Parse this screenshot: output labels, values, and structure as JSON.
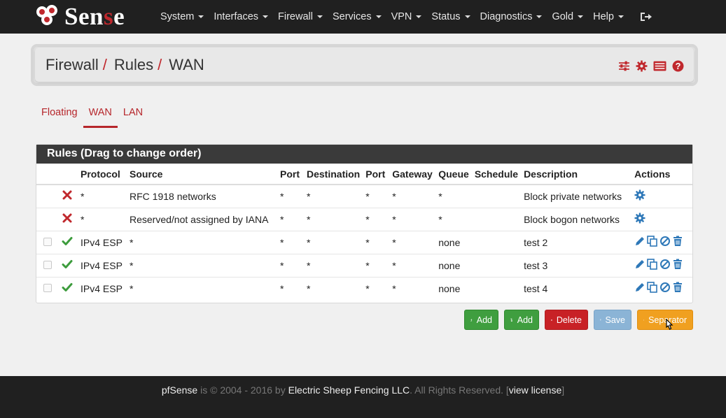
{
  "navbar": {
    "logo_text_a": "Sen",
    "logo_text_b": "s",
    "logo_text_c": "e",
    "items": [
      {
        "label": "System"
      },
      {
        "label": "Interfaces"
      },
      {
        "label": "Firewall"
      },
      {
        "label": "Services"
      },
      {
        "label": "VPN"
      },
      {
        "label": "Status"
      },
      {
        "label": "Diagnostics"
      },
      {
        "label": "Gold"
      },
      {
        "label": "Help"
      }
    ]
  },
  "breadcrumb": {
    "part1": "Firewall",
    "sep": "/",
    "part2": "Rules",
    "part3": "WAN",
    "icons": [
      "sliders-icon",
      "gear-icon",
      "list-icon",
      "help-icon"
    ]
  },
  "tabs": [
    {
      "label": "Floating"
    },
    {
      "label": "WAN"
    },
    {
      "label": "LAN"
    }
  ],
  "rules": {
    "title": "Rules (Drag to change order)",
    "columns": [
      "Protocol",
      "Source",
      "Port",
      "Destination",
      "Port",
      "Gateway",
      "Queue",
      "Schedule",
      "Description",
      "Actions"
    ],
    "rows": [
      {
        "status": "block",
        "protocol": "*",
        "source": "RFC 1918 networks",
        "port": "*",
        "destination": "*",
        "dport": "*",
        "gateway": "*",
        "queue": "*",
        "schedule": "",
        "description": "Block private networks"
      },
      {
        "status": "block",
        "protocol": "*",
        "source": "Reserved/not assigned by IANA",
        "port": "*",
        "destination": "*",
        "dport": "*",
        "gateway": "*",
        "queue": "*",
        "schedule": "",
        "description": "Block bogon networks"
      },
      {
        "status": "pass",
        "protocol": "IPv4 ESP",
        "source": "*",
        "port": "*",
        "destination": "*",
        "dport": "*",
        "gateway": "*",
        "queue": "none",
        "schedule": "",
        "description": "test 2"
      },
      {
        "status": "pass",
        "protocol": "IPv4 ESP",
        "source": "*",
        "port": "*",
        "destination": "*",
        "dport": "*",
        "gateway": "*",
        "queue": "none",
        "schedule": "",
        "description": "test 3"
      },
      {
        "status": "pass",
        "protocol": "IPv4 ESP",
        "source": "*",
        "port": "*",
        "destination": "*",
        "dport": "*",
        "gateway": "*",
        "queue": "none",
        "schedule": "",
        "description": "test 4"
      }
    ]
  },
  "buttons": {
    "add_top": "Add",
    "add_bottom": "Add",
    "delete": "Delete",
    "save": "Save",
    "separator": "Separator"
  },
  "footer": {
    "brand": "pfSense",
    "mid": " is © 2004 - 2016 by ",
    "company": "Electric Sheep Fencing LLC",
    "rights": ". All Rights Reserved. [",
    "license": "view license",
    "end": "]"
  },
  "colors": {
    "brand_red": "#c0282d",
    "navbar": "#202020",
    "pass_green": "#3d9c3d",
    "block_red": "#c0282d",
    "action_blue": "#2e78b8"
  }
}
